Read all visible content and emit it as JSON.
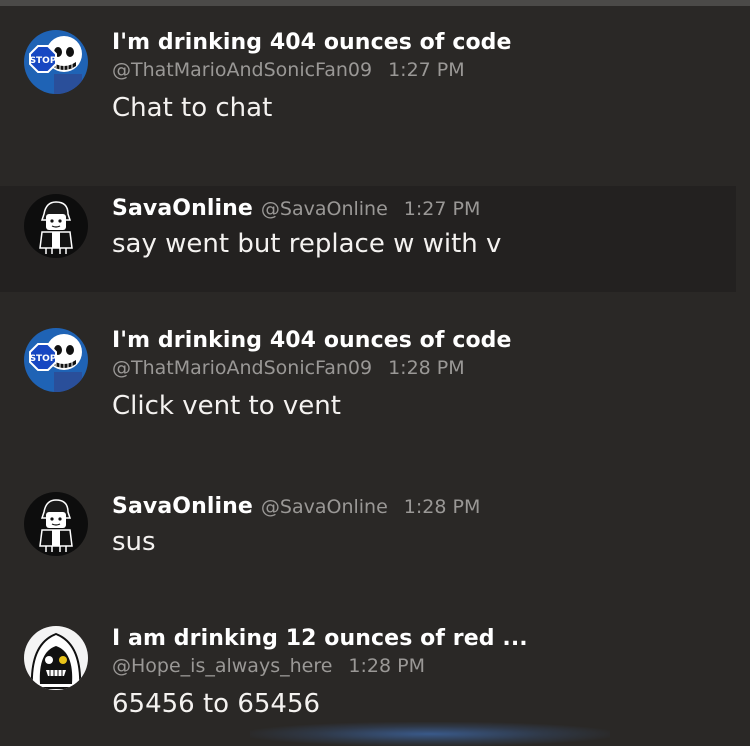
{
  "messages": [
    {
      "display_name": "I'm drinking 404 ounces of code",
      "handle": "@ThatMarioAndSonicFan09",
      "time": "1:27 PM",
      "text": "Chat to chat",
      "avatar": "sans-stop-sign-avatar",
      "avatar_sign_text": "STOP"
    },
    {
      "display_name": "SavaOnline",
      "handle": "@SavaOnline",
      "time": "1:27 PM",
      "text": "say went but replace w with v",
      "avatar": "dark-hair-character-avatar"
    },
    {
      "display_name": "I'm drinking 404 ounces of code",
      "handle": "@ThatMarioAndSonicFan09",
      "time": "1:28 PM",
      "text": "Click vent to vent",
      "avatar": "sans-stop-sign-avatar",
      "avatar_sign_text": "STOP"
    },
    {
      "display_name": "SavaOnline",
      "handle": "@SavaOnline",
      "time": "1:28 PM",
      "text": "sus",
      "avatar": "dark-hair-character-avatar"
    },
    {
      "display_name": "I am drinking 12 ounces of red ...",
      "handle": "@Hope_is_always_here",
      "time": "1:28 PM",
      "text": "65456 to 65456",
      "avatar": "hooded-skull-avatar"
    }
  ],
  "colors": {
    "background": "#2a2826",
    "hover_row": "#232120",
    "name": "#ffffff",
    "meta": "#9a9896",
    "body_text": "#f4f2f0"
  }
}
